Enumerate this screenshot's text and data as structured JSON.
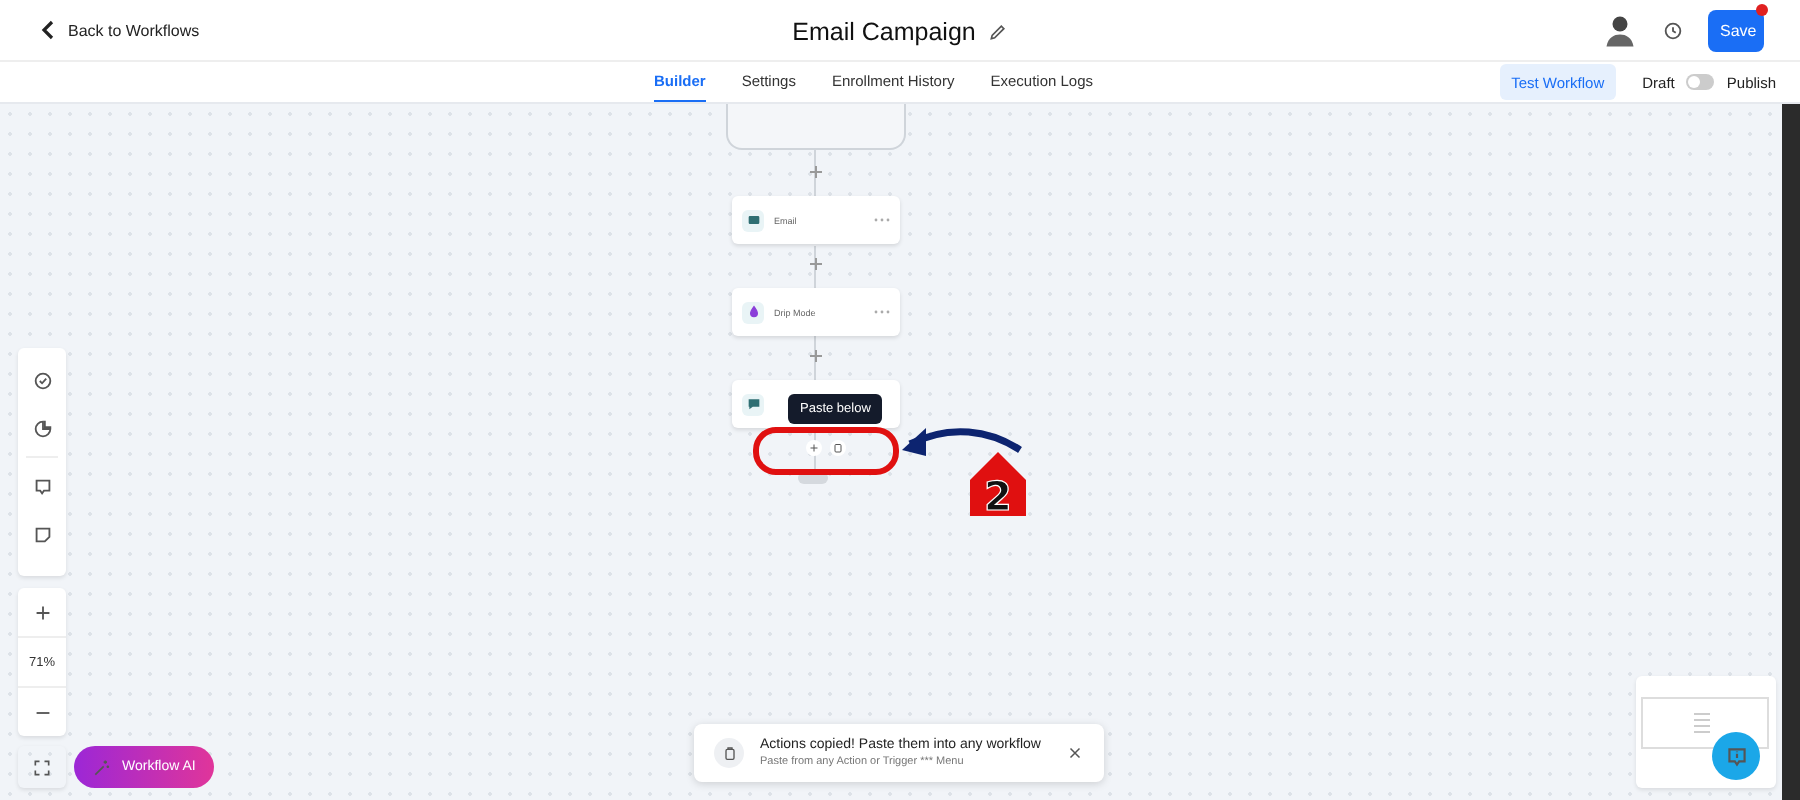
{
  "header": {
    "back": "Back to Workflows",
    "title": "Email Campaign",
    "save": "Save",
    "save_badge": true
  },
  "tabs": [
    {
      "label": "Builder",
      "selected": true
    },
    {
      "label": "Settings",
      "selected": false
    },
    {
      "label": "Enrollment History",
      "selected": false
    },
    {
      "label": "Execution Logs",
      "selected": false
    }
  ],
  "test_button": "Test Workflow",
  "publish": {
    "off_label": "Draft",
    "on_label": "Publish",
    "on": false
  },
  "nodes": [
    {
      "label": "Email",
      "kind": "email",
      "color": "#2f6f73"
    },
    {
      "label": "Drip Mode",
      "kind": "drip",
      "color": "#8b3fd9"
    },
    {
      "kind": "sms",
      "color": "#2f6f73"
    }
  ],
  "tooltip": "Paste below",
  "annotation": {
    "label": "2"
  },
  "zoom": {
    "level_text": "71%"
  },
  "ai_button": "Workflow AI",
  "toast": {
    "title": "Actions copied! Paste them into any workflow",
    "subtitle": "Paste from any Action or Trigger *** Menu"
  }
}
